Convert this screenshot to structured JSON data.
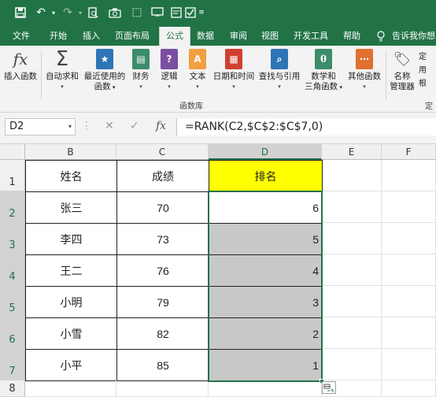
{
  "colors": {
    "accent": "#217346",
    "rank_header_fill": "#ffff00",
    "selection_fill": "#c8c8c8"
  },
  "qat": {
    "icons": [
      "save-icon",
      "undo-icon",
      "undo-dropdown-icon",
      "redo-icon",
      "redo-dropdown-icon",
      "print-preview-icon",
      "camera-icon",
      "screen-clip-icon",
      "present-icon",
      "form-icon",
      "checkbox-icon",
      "customize-qat-icon"
    ]
  },
  "tabs": [
    "文件",
    "开始",
    "插入",
    "页面布局",
    "公式",
    "数据",
    "审阅",
    "视图",
    "开发工具",
    "帮助"
  ],
  "tell_me": "告诉我你想",
  "ribbon": {
    "buttons": [
      {
        "label1": "插入函数",
        "label2": "",
        "icon": "fx-icon"
      },
      {
        "label1": "自动求和",
        "label2": "",
        "icon": "sigma-icon"
      },
      {
        "label1": "最近使用的",
        "label2": "函数",
        "icon": "star-icon"
      },
      {
        "label1": "财务",
        "label2": "",
        "icon": "finance-icon"
      },
      {
        "label1": "逻辑",
        "label2": "",
        "icon": "logic-icon"
      },
      {
        "label1": "文本",
        "label2": "",
        "icon": "text-icon"
      },
      {
        "label1": "日期和时间",
        "label2": "",
        "icon": "calendar-icon"
      },
      {
        "label1": "查找与引用",
        "label2": "",
        "icon": "lookup-icon"
      },
      {
        "label1": "数学和",
        "label2": "三角函数",
        "icon": "theta-icon"
      },
      {
        "label1": "其他函数",
        "label2": "",
        "icon": "more-functions-icon"
      },
      {
        "label1": "名称",
        "label2": "管理器",
        "icon": "name-manager-icon"
      }
    ],
    "group_label": "函数库",
    "group_label_2": "定",
    "right_labels": [
      "定",
      "用",
      "根"
    ]
  },
  "formula_bar": {
    "name_box": "D2",
    "formula": "=RANK(C2,$C$2:$C$7,0)",
    "cancel": "✕",
    "enter": "✓",
    "fx": "fx"
  },
  "columns": [
    "B",
    "C",
    "D",
    "E",
    "F"
  ],
  "rows": [
    "1",
    "2",
    "3",
    "4",
    "5",
    "6",
    "7",
    "8"
  ],
  "table": {
    "headers": [
      "姓名",
      "成绩",
      "排名"
    ],
    "rows": [
      [
        "张三",
        "70",
        "6"
      ],
      [
        "李四",
        "73",
        "5"
      ],
      [
        "王二",
        "76",
        "4"
      ],
      [
        "小明",
        "79",
        "3"
      ],
      [
        "小雪",
        "82",
        "2"
      ],
      [
        "小平",
        "85",
        "1"
      ]
    ]
  }
}
